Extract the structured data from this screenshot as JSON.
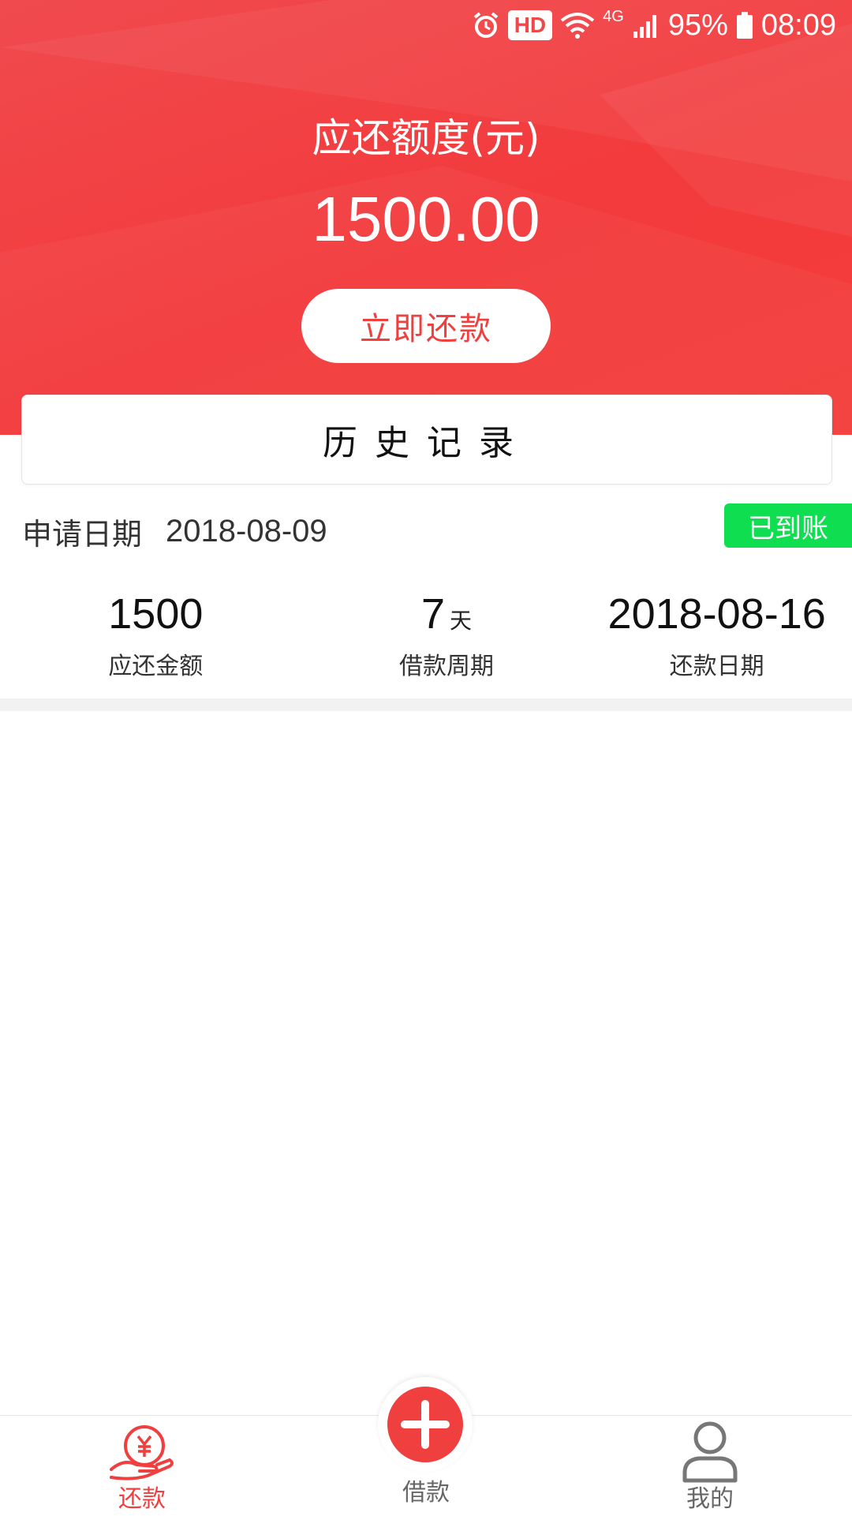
{
  "status_bar": {
    "hd": "HD",
    "network": "4G",
    "battery": "95%",
    "time": "08:09"
  },
  "header": {
    "title": "应还额度(元)",
    "amount": "1500.00",
    "repay_button": "立即还款"
  },
  "history": {
    "title": "历史记录"
  },
  "record": {
    "apply_label": "申请日期",
    "apply_date": "2018-08-09",
    "status": "已到账",
    "stats": [
      {
        "value": "1500",
        "unit": "",
        "label": "应还金额"
      },
      {
        "value": "7",
        "unit": "天",
        "label": "借款周期"
      },
      {
        "value": "2018-08-16",
        "unit": "",
        "label": "还款日期"
      }
    ]
  },
  "tabbar": {
    "repay": "还款",
    "borrow": "借款",
    "mine": "我的"
  },
  "colors": {
    "brand_red": "#ef3f3f",
    "status_green": "#0ede4f"
  }
}
